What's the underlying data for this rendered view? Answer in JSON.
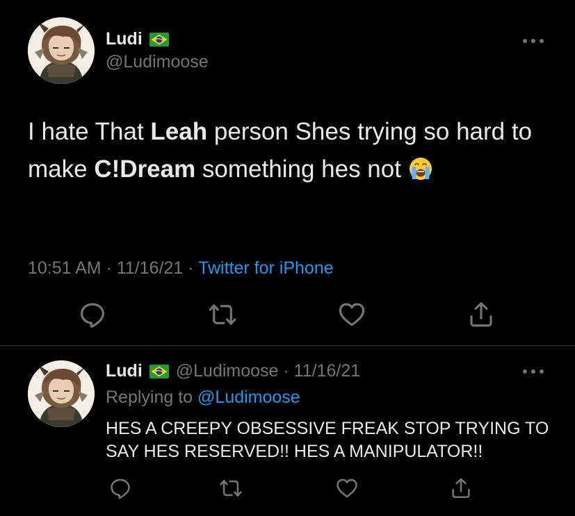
{
  "main_tweet": {
    "author": {
      "display_name": "Ludi",
      "handle": "@Ludimoose",
      "flag": "brazil-flag"
    },
    "text_segments": [
      {
        "text": "I hate That ",
        "bold": false
      },
      {
        "text": "Leah",
        "bold": true
      },
      {
        "text": " person Shes trying so hard to make ",
        "bold": false
      },
      {
        "text": "C!Dream",
        "bold": true
      },
      {
        "text": " something hes not ",
        "bold": false
      }
    ],
    "emoji": "loudly-crying-face",
    "meta": {
      "time": "10:51 AM",
      "separator": " · ",
      "date": "11/16/21",
      "source": "Twitter for iPhone"
    },
    "actions": [
      "reply-icon",
      "retweet-icon",
      "like-icon",
      "share-icon"
    ]
  },
  "reply_tweet": {
    "author": {
      "display_name": "Ludi",
      "handle_date": "@Ludimoose · 11/16/21",
      "flag": "brazil-flag"
    },
    "replying_to_label": "Replying to ",
    "replying_to_handle": "@Ludimoose",
    "text": "HES A CREEPY OBSESSIVE FREAK STOP TRYING TO SAY HES RESERVED!! HES A MANIPULATOR!!",
    "actions": [
      "reply-icon",
      "retweet-icon",
      "like-icon",
      "share-icon"
    ]
  },
  "colors": {
    "background": "#000000",
    "text": "#e7e9ea",
    "secondary": "#71767b",
    "accent": "#1d9bf0",
    "divider": "#2f3336"
  }
}
